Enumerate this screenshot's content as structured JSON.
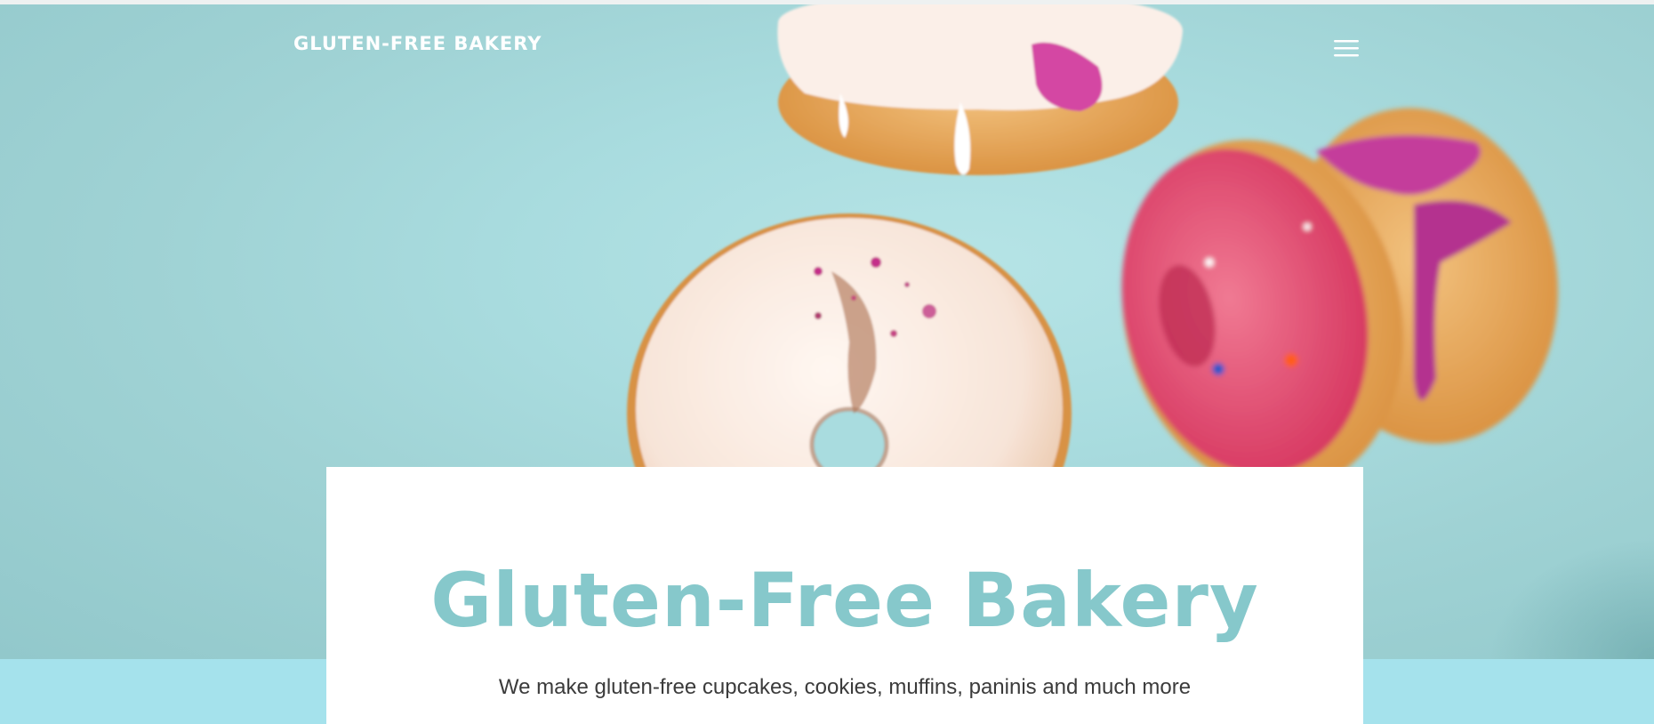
{
  "header": {
    "brand": "GLUTEN-FREE BAKERY",
    "menu_icon": "hamburger-menu-icon"
  },
  "hero": {
    "image": "donuts-falling-photo",
    "title": "Gluten-Free Bakery",
    "subtitle": "We make gluten-free cupcakes, cookies, muffins, paninis and much more"
  },
  "colors": {
    "hero_background": "#a9dcdf",
    "title": "#86c8cb",
    "bottom_band": "#a5e2ec",
    "subtitle": "#3b3b3b",
    "card": "#ffffff"
  }
}
